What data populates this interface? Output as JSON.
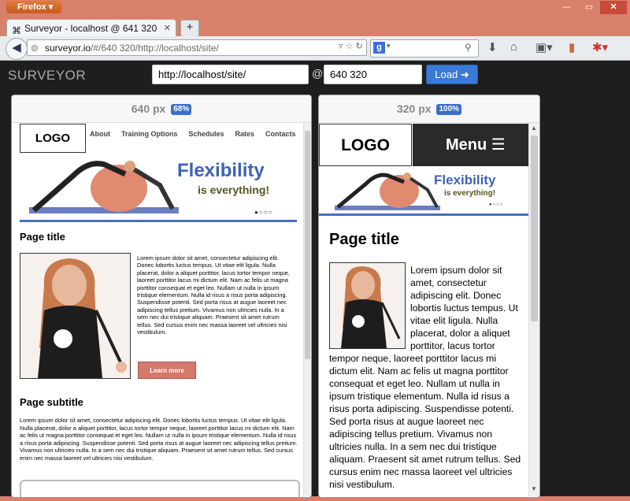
{
  "browser": {
    "app_button": "Firefox",
    "tab_title": "Surveyor - localhost @ 641 320",
    "new_tab": "+",
    "url_host": "surveyor.io",
    "url_rest": "/#/640 320/http://localhost/site/",
    "colors": {
      "accent": "#3a7ad6",
      "titlebar": "#d9806b"
    }
  },
  "app": {
    "logo": "SURVEYOR",
    "url_value": "http://localhost/site/",
    "at": "@",
    "size_value": "640 320",
    "load_label": "Load"
  },
  "panel1": {
    "width_label": "640 px",
    "zoom": "68%",
    "site": {
      "logo": "LOGO",
      "nav": [
        "About",
        "Training Options",
        "Schedules",
        "Rates",
        "Contacts"
      ],
      "banner_title": "Flexibility",
      "banner_sub": "is everything!",
      "page_title": "Page title",
      "body": "Lorem ipsum dolor sit amet, consectetur adipiscing elit. Donec lobortis luctus tempus. Ut vitae elit ligula. Nulla placerat, dolor a aliquet porttitor, lacus tortor tempor neque, laoreet porttitor lacus mi dictum elit. Nam ac felis ut magna porttitor consequat et eget leo. Nullam ut nulla in ipsum tristique elementum. Nulla id risus a risus porta adipiscing. Suspendisse potenti. Sed porta risus at augue laoreet nec adipiscing tellus pretium. Vivamus non ultricies nulla. In a sem nec dui tristique aliquam. Praesent sit amet rutrum tellus. Sed cursus enim nec massa laoreet vel ultricies nisi vestibulum.",
      "learn_more": "Learn more",
      "subtitle": "Page subtitle",
      "sub_body": "Lorem ipsum dolor sit amet, consectetur adipiscing elit. Donec lobortis luctus tempus. Ut vitae elit ligula. Nulla placerat, dolor a aliquet porttitor, lacus tortor tempor neque, laoreet porttitor lacus mi dictum elit. Nam ac felis ut magna porttitor consequat et eget leo. Nullam ut nulla in ipsum tristique elementum. Nulla id risus a risus porta adipiscing. Suspendisse potenti. Sed porta risus at augue laoreet nec adipiscing tellus pretium. Vivamus non ultricies nulla. In a sem nec dui tristique aliquam. Praesent sit amet rutrum tellus. Sed cursus enim nec massa laoreet vel ultricies nisi vestibulum."
    }
  },
  "panel2": {
    "width_label": "320 px",
    "zoom": "100%",
    "site": {
      "logo": "LOGO",
      "menu": "Menu",
      "banner_title": "Flexibility",
      "banner_sub": "is everything!",
      "page_title": "Page title",
      "body": "Lorem ipsum dolor sit amet, consectetur adipiscing elit. Donec lobortis luctus tempus. Ut vitae elit ligula. Nulla placerat, dolor a aliquet porttitor, lacus tortor tempor neque, laoreet porttitor lacus mi dictum elit. Nam ac felis ut magna porttitor consequat et eget leo. Nullam ut nulla in ipsum tristique elementum. Nulla id risus a risus porta adipiscing. Suspendisse potenti. Sed porta risus at augue laoreet nec adipiscing tellus pretium. Vivamus non ultricies nulla. In a sem nec dui tristique aliquam. Praesent sit amet rutrum tellus. Sed cursus enim nec massa laoreet vel ultricies nisi vestibulum."
    }
  },
  "icons": {
    "back": "back-arrow-icon",
    "reload": "reload-icon",
    "download": "download-icon",
    "home": "home-icon",
    "load": "circle-arrow-right-icon"
  }
}
